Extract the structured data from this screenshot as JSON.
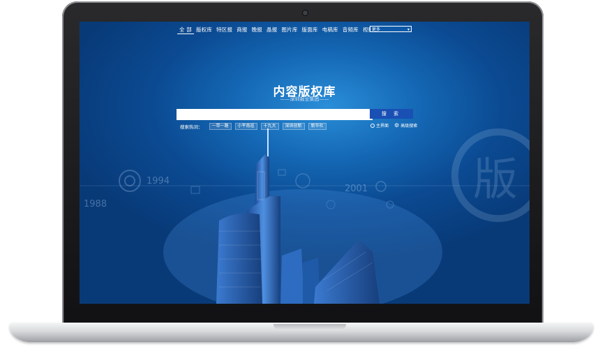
{
  "nav": {
    "items": [
      "全 部",
      "版权库",
      "特区报",
      "商报",
      "晚报",
      "晶报",
      "图片库",
      "版面库",
      "电稿库",
      "音频库",
      "视频库"
    ],
    "more": "更多"
  },
  "title": "内容版权库",
  "subtitle": "——深圳报业集团——",
  "search": {
    "placeholder": "",
    "button": "搜 索"
  },
  "hot": {
    "label": "搜索热词：",
    "tags": [
      "一带一路",
      "小平南巡",
      "十九大",
      "深圳创新",
      "新华社"
    ]
  },
  "tools": {
    "home": "主界面",
    "advanced": "高级搜索"
  },
  "decor": {
    "years": [
      "1994",
      "1988",
      "2001"
    ],
    "seal_char": "版"
  },
  "colors": {
    "accent": "#1a4fb4",
    "screen_bg": "#1467b4"
  }
}
